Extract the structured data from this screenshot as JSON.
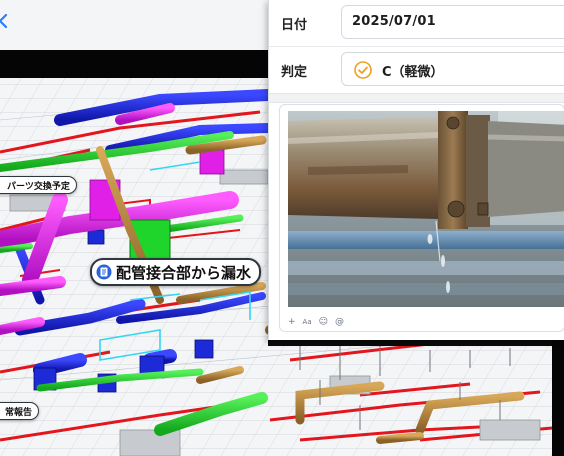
{
  "app": {
    "background": "#ffffff",
    "accent": "#f0a020"
  },
  "viewer": {
    "back_icon": "chevron-left-icon",
    "markers": [
      {
        "id": "parts",
        "label": "パーツ交換予定",
        "icon": "pin-icon"
      },
      {
        "id": "leak",
        "label": "配管接合部から漏水",
        "icon": "document-list-icon"
      },
      {
        "id": "report",
        "label": "常報告",
        "icon": "pin-icon"
      }
    ],
    "pipe_colors": {
      "blue": "#1c2ad8",
      "magenta": "#e020e6",
      "green": "#1fd42a",
      "brown": "#b88a3a",
      "red": "#e2161c",
      "cyan": "#34d6f0",
      "grey": "#bfc4c8"
    }
  },
  "form": {
    "date": {
      "label": "日付",
      "value": "2025/07/01"
    },
    "judgement": {
      "label": "判定",
      "value": "C（軽微）",
      "icon": "check-circle-icon",
      "color": "#f0a020"
    },
    "attachment": {
      "description_icon": "photo-icon"
    },
    "toolbar": [
      {
        "id": "add",
        "glyph": "+",
        "icon": "plus-icon"
      },
      {
        "id": "format",
        "glyph": "Aa",
        "icon": "text-format-icon"
      },
      {
        "id": "emoji",
        "glyph": "☺",
        "icon": "emoji-icon"
      },
      {
        "id": "mention",
        "glyph": "@",
        "icon": "mention-icon"
      }
    ]
  }
}
